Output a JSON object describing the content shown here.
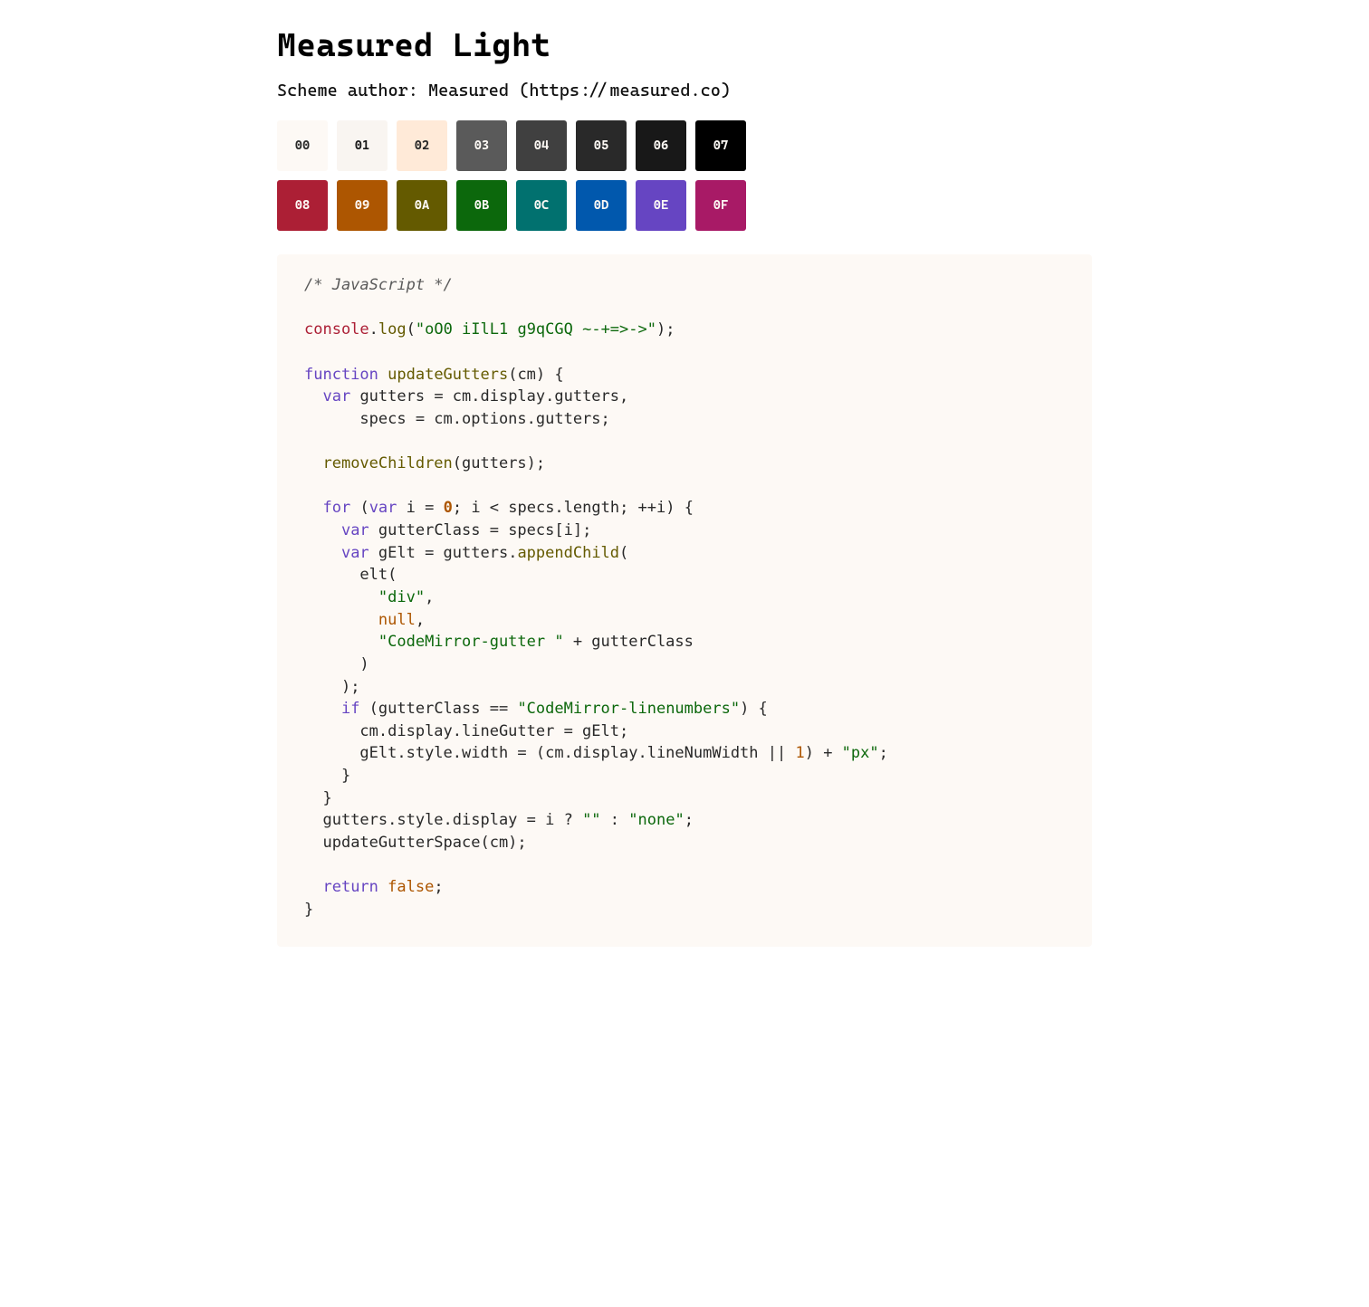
{
  "title": "Measured Light",
  "author_line": "Scheme author: Measured (https://measured.co)",
  "palette": {
    "base00": {
      "label": "00",
      "bg": "#fdf9f5",
      "fg": "#292929"
    },
    "base01": {
      "label": "01",
      "bg": "#f9f5f1",
      "fg": "#181818"
    },
    "base02": {
      "label": "02",
      "bg": "#ffead8",
      "fg": "#292929"
    },
    "base03": {
      "label": "03",
      "bg": "#5a5a5a",
      "fg": "#fdf9f5"
    },
    "base04": {
      "label": "04",
      "bg": "#404040",
      "fg": "#fdf9f5"
    },
    "base05": {
      "label": "05",
      "bg": "#292929",
      "fg": "#fdf9f5"
    },
    "base06": {
      "label": "06",
      "bg": "#181818",
      "fg": "#fdf9f5"
    },
    "base07": {
      "label": "07",
      "bg": "#000000",
      "fg": "#fdf9f5"
    },
    "base08": {
      "label": "08",
      "bg": "#ac1f35",
      "fg": "#fdf9f5"
    },
    "base09": {
      "label": "09",
      "bg": "#ad5601",
      "fg": "#fdf9f5"
    },
    "base0A": {
      "label": "0A",
      "bg": "#645a00",
      "fg": "#fdf9f5"
    },
    "base0B": {
      "label": "0B",
      "bg": "#0c680c",
      "fg": "#fdf9f5"
    },
    "base0C": {
      "label": "0C",
      "bg": "#01716f",
      "fg": "#fdf9f5"
    },
    "base0D": {
      "label": "0D",
      "bg": "#0158ad",
      "fg": "#fdf9f5"
    },
    "base0E": {
      "label": "0E",
      "bg": "#6645c2",
      "fg": "#fdf9f5"
    },
    "base0F": {
      "label": "0F",
      "bg": "#a81a66",
      "fg": "#fdf9f5"
    }
  },
  "roles": {
    "code_bg": "#fdf9f5",
    "code_fg": "#292929",
    "comment_fg": "#5a5a5a",
    "red": "#ac1f35",
    "orange": "#ad5601",
    "yellow": "#645a00",
    "green": "#0c680c",
    "cyan": "#01716f",
    "blue": "#0158ad",
    "purple": "#6645c2",
    "magenta": "#a81a66"
  },
  "code": {
    "comment": "/* JavaScript */",
    "l3": {
      "a": "console",
      "b": ".",
      "c": "log",
      "d": "(",
      "e": "\"oO0 iIlL1 g9qCGQ ~-+=>->\"",
      "f": ");"
    },
    "l5": {
      "a": "function",
      "sp": " ",
      "b": "updateGutters",
      "c": "(cm) {"
    },
    "l6": {
      "indent": "  ",
      "a": "var",
      "b": " gutters = cm.display.gutters,"
    },
    "l7": {
      "indent": "      ",
      "a": "specs = cm.options.gutters;"
    },
    "l9": {
      "indent": "  ",
      "a": "removeChildren",
      "b": "(gutters);"
    },
    "l11": {
      "indent": "  ",
      "a": "for",
      "b": " (",
      "c": "var",
      "d": " i = ",
      "e": "0",
      "f": "; i < specs.length; ++i) {"
    },
    "l12": {
      "indent": "    ",
      "a": "var",
      "b": " gutterClass = specs[i];"
    },
    "l13": {
      "indent": "    ",
      "a": "var",
      "b": " gElt = gutters.",
      "c": "appendChild",
      "d": "("
    },
    "l14": {
      "indent": "      ",
      "a": "elt("
    },
    "l15": {
      "indent": "        ",
      "a": "\"div\"",
      "b": ","
    },
    "l16": {
      "indent": "        ",
      "a": "null",
      "b": ","
    },
    "l17": {
      "indent": "        ",
      "a": "\"CodeMirror-gutter \"",
      "b": " + gutterClass"
    },
    "l18": {
      "indent": "      ",
      "a": ")"
    },
    "l19": {
      "indent": "    ",
      "a": ");"
    },
    "l20": {
      "indent": "    ",
      "a": "if",
      "b": " (gutterClass == ",
      "c": "\"CodeMirror-linenumbers\"",
      "d": ") {"
    },
    "l21": {
      "indent": "      ",
      "a": "cm.display.lineGutter = gElt;"
    },
    "l22": {
      "indent": "      ",
      "a": "gElt.style.width = (cm.display.lineNumWidth || ",
      "b": "1",
      "c": ") + ",
      "d": "\"px\"",
      "e": ";"
    },
    "l23": {
      "indent": "    ",
      "a": "}"
    },
    "l24": {
      "indent": "  ",
      "a": "}"
    },
    "l25": {
      "indent": "  ",
      "a": "gutters.style.display = i ? ",
      "b": "\"\"",
      "c": " : ",
      "d": "\"none\"",
      "e": ";"
    },
    "l26": {
      "indent": "  ",
      "a": "updateGutterSpace(cm);"
    },
    "l28": {
      "indent": "  ",
      "a": "return",
      "b": " ",
      "c": "false",
      "d": ";"
    },
    "l29": {
      "a": "}"
    }
  }
}
